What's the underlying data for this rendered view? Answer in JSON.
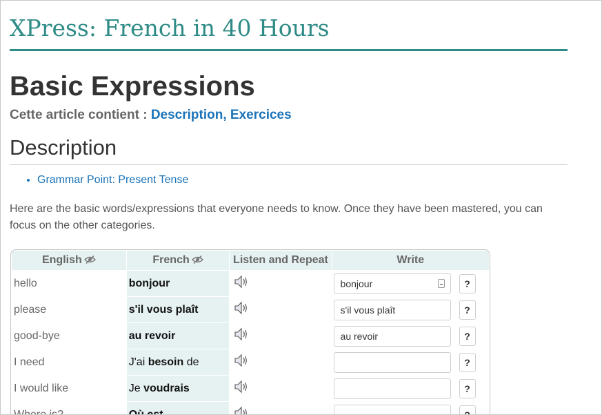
{
  "site": {
    "title": "XPress: French in 40 Hours"
  },
  "page": {
    "title": "Basic Expressions"
  },
  "toc": {
    "label": "Cette article contient :",
    "items": [
      "Description",
      "Exercices"
    ],
    "separator": ","
  },
  "section": {
    "title": "Description"
  },
  "links": [
    "Grammar Point: Present Tense"
  ],
  "intro": "Here are the basic words/expressions that everyone needs to know. Once they have been mastered, you can focus on the other categories.",
  "vocab_table": {
    "headers": {
      "english": "English",
      "french": "French",
      "listen": "Listen and Repeat",
      "write": "Write"
    },
    "check_label": "?",
    "rows": [
      {
        "english": "hello",
        "fr_pre": "",
        "fr_bold": "bonjour",
        "fr_post": "",
        "written": "bonjour"
      },
      {
        "english": "please",
        "fr_pre": "",
        "fr_bold": "s'il vous plaît",
        "fr_post": "",
        "written": "s'il vous plaît"
      },
      {
        "english": "good-bye",
        "fr_pre": "",
        "fr_bold": "au revoir",
        "fr_post": "",
        "written": "au revoir"
      },
      {
        "english": "I need",
        "fr_pre": "J'ai ",
        "fr_bold": "besoin",
        "fr_post": " de",
        "written": ""
      },
      {
        "english": "I would like",
        "fr_pre": "Je ",
        "fr_bold": "voudrais",
        "fr_post": "",
        "written": ""
      },
      {
        "english": "Where is?",
        "fr_pre": "",
        "fr_bold": "Où est",
        "fr_post": "",
        "written": ""
      }
    ]
  },
  "colors": {
    "brand": "#2e8b86",
    "link": "#1a73b8",
    "header_bg": "#e6f1f1"
  },
  "icons": {
    "hide": "eye-slash-icon",
    "audio": "speaker-icon",
    "keyboard": "keyboard-icon"
  }
}
